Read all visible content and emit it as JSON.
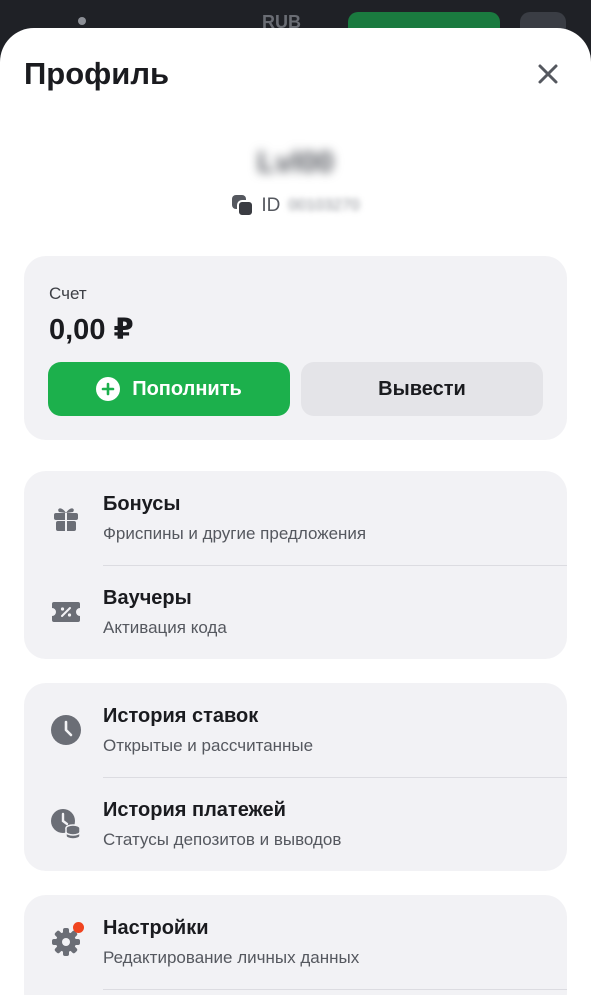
{
  "backdrop": {
    "currency": "RUB"
  },
  "header": {
    "title": "Профиль"
  },
  "user": {
    "name": "Lvl00",
    "id_label": "ID",
    "id_value": "00103270"
  },
  "account": {
    "label": "Счет",
    "balance": "0,00 ₽",
    "deposit_label": "Пополнить",
    "withdraw_label": "Вывести"
  },
  "menu": {
    "bonuses": {
      "title": "Бонусы",
      "subtitle": "Фриспины и другие предложения",
      "icon": "gift-icon"
    },
    "vouchers": {
      "title": "Ваучеры",
      "subtitle": "Активация кода",
      "icon": "voucher-icon"
    },
    "bet_history": {
      "title": "История ставок",
      "subtitle": "Открытые и рассчитанные",
      "icon": "clock-icon"
    },
    "payment_history": {
      "title": "История платежей",
      "subtitle": "Статусы депозитов и выводов",
      "icon": "payment-history-icon"
    },
    "settings": {
      "title": "Настройки",
      "subtitle": "Редактирование личных данных",
      "icon": "gear-icon"
    }
  },
  "colors": {
    "accent_green": "#1cb04c",
    "notification": "#f0441f",
    "card_bg": "#f2f2f5",
    "icon_gray": "#6b6e76"
  }
}
